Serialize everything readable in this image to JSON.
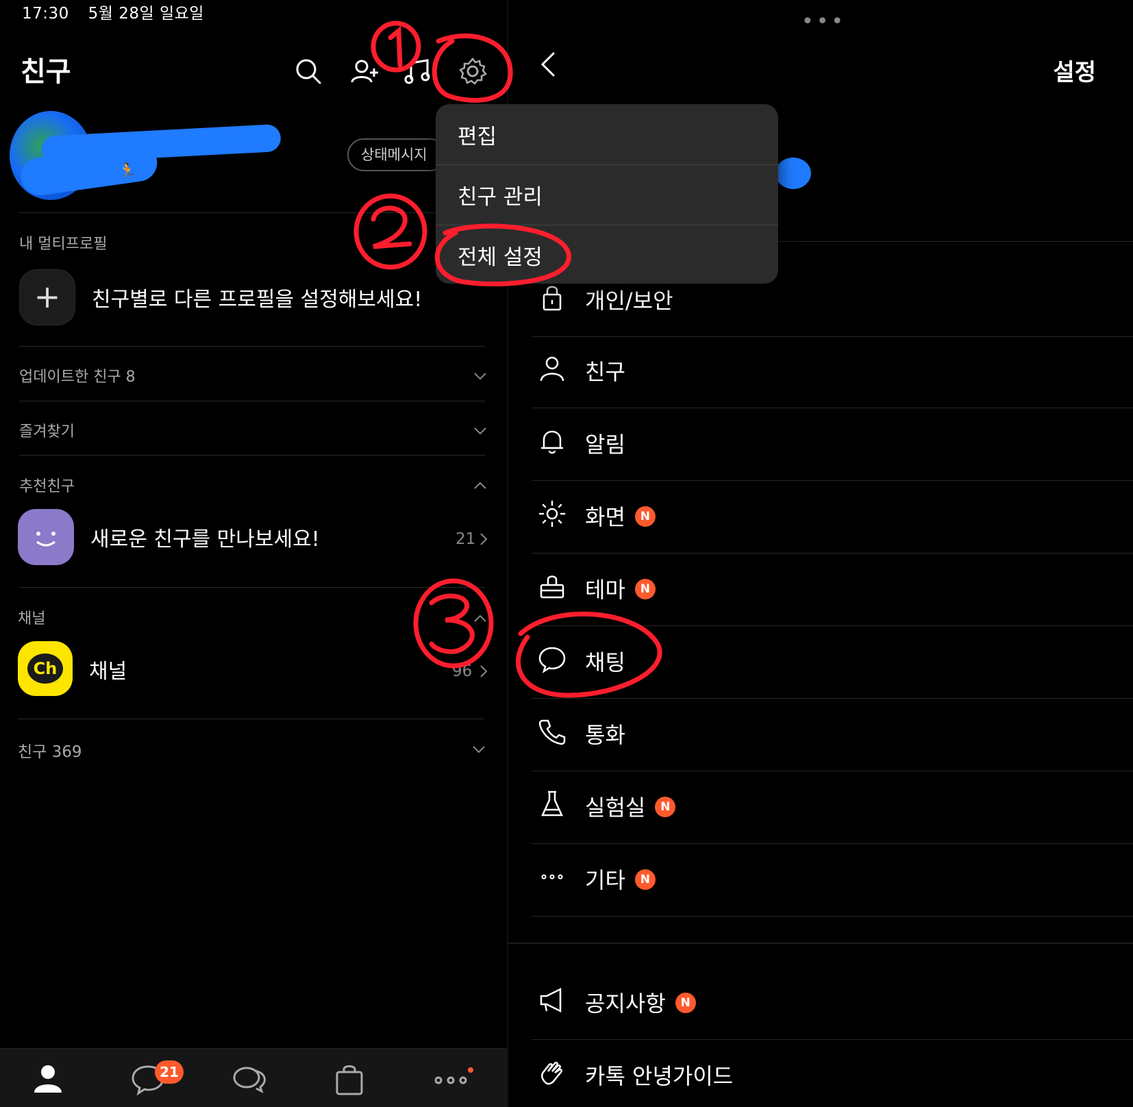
{
  "status_bar": {
    "time": "17:30",
    "date": "5월 28일 일요일"
  },
  "left": {
    "title": "친구",
    "status_message_button": "상태메시지",
    "multi_profile": {
      "section": "내 멀티프로필",
      "prompt": "친구별로 다른 프로필을 설정해보세요!"
    },
    "sections": {
      "updated_friends": "업데이트한 친구 8",
      "favorites": "즐겨찾기",
      "recommended": "추천친구",
      "recommended_item": "새로운 친구를 만나보세요!",
      "recommended_count": "21",
      "channel_section": "채널",
      "channel_item": "채널",
      "channel_logo": "Ch",
      "channel_count": "96",
      "friends": "친구 369"
    },
    "tabbar": {
      "chat_badge": "21"
    }
  },
  "menu": {
    "items": [
      "편집",
      "친구 관리",
      "전체 설정"
    ]
  },
  "right": {
    "more_dots": "•••",
    "title": "설정",
    "badge_label": "N",
    "items": [
      {
        "label": "개인/보안",
        "icon": "lock-icon",
        "new": false
      },
      {
        "label": "친구",
        "icon": "person-icon",
        "new": false
      },
      {
        "label": "알림",
        "icon": "bell-icon",
        "new": false
      },
      {
        "label": "화면",
        "icon": "brightness-icon",
        "new": true
      },
      {
        "label": "테마",
        "icon": "theme-brush-icon",
        "new": true
      },
      {
        "label": "채팅",
        "icon": "chat-bubble-icon",
        "new": false
      },
      {
        "label": "통화",
        "icon": "phone-icon",
        "new": false
      },
      {
        "label": "실험실",
        "icon": "flask-icon",
        "new": true
      },
      {
        "label": "기타",
        "icon": "more-icon",
        "new": true
      }
    ],
    "extra_items": [
      {
        "label": "공지사항",
        "icon": "megaphone-icon",
        "new": true
      },
      {
        "label": "카톡 안녕가이드",
        "icon": "wave-hand-icon",
        "new": false
      }
    ]
  },
  "annotations": {
    "color": "#ff1e2d",
    "step1": "①",
    "step2": "②",
    "step3": "③"
  },
  "colors": {
    "badge": "#ff5a2d",
    "channel_yellow": "#fee500",
    "recommend_purple": "#8b79c9",
    "scribble_blue": "#1f7bff"
  }
}
